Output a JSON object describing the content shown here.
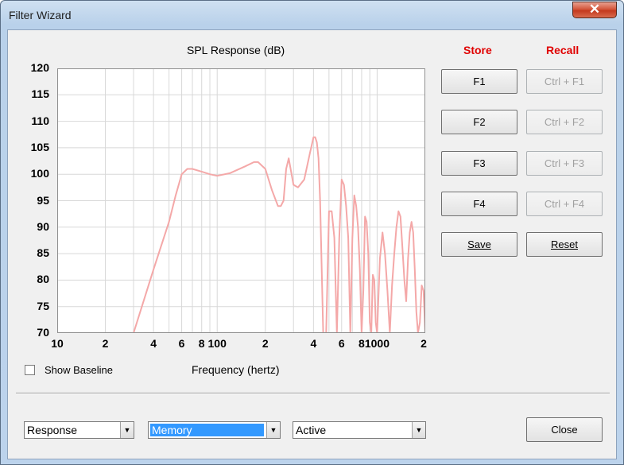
{
  "window": {
    "title": "Filter Wizard",
    "close_glyph": "✕"
  },
  "header": {
    "store": "Store",
    "recall": "Recall"
  },
  "chart_data": {
    "type": "line",
    "title": "SPL Response (dB)",
    "xlabel": "Frequency (hertz)",
    "ylabel": "",
    "x_scale": "log",
    "xlim": [
      10,
      2000
    ],
    "ylim": [
      70,
      120
    ],
    "y_ticks": [
      "120",
      "115",
      "110",
      "105",
      "100",
      "95",
      "90",
      "85",
      "80",
      "75",
      "70"
    ],
    "x_ticks": [
      {
        "v": 10,
        "label": "10"
      },
      {
        "v": 20,
        "label": "2"
      },
      {
        "v": 40,
        "label": "4"
      },
      {
        "v": 60,
        "label": "6"
      },
      {
        "v": 80,
        "label": "8"
      },
      {
        "v": 100,
        "label": "100"
      },
      {
        "v": 200,
        "label": "2"
      },
      {
        "v": 400,
        "label": "4"
      },
      {
        "v": 600,
        "label": "6"
      },
      {
        "v": 800,
        "label": "8"
      },
      {
        "v": 1000,
        "label": "1000"
      },
      {
        "v": 2000,
        "label": "2"
      }
    ],
    "grid": true,
    "series_color": "#f4a8a8",
    "series": [
      {
        "x": [
          30,
          40,
          50,
          55,
          60,
          65,
          70,
          80,
          90,
          100,
          120,
          150,
          170,
          180,
          200,
          220,
          240,
          250,
          260,
          270,
          280,
          300,
          320,
          350,
          380,
          400,
          410,
          420,
          430,
          440,
          460,
          480,
          500,
          520,
          540,
          560,
          580,
          600,
          620,
          640,
          660,
          680,
          700,
          720,
          740,
          760,
          780,
          800,
          820,
          840,
          860,
          880,
          900,
          920,
          940,
          960,
          980,
          1000,
          1040,
          1080,
          1120,
          1160,
          1200,
          1240,
          1280,
          1320,
          1360,
          1400,
          1440,
          1480,
          1520,
          1560,
          1600,
          1640,
          1680,
          1720,
          1760,
          1800,
          1850,
          1900,
          1950,
          2000
        ],
        "y": [
          70,
          82,
          91,
          96,
          100,
          101,
          101,
          100.5,
          100,
          99.7,
          100.2,
          101.5,
          102.3,
          102.3,
          101,
          97,
          94,
          94,
          95,
          101,
          103,
          98,
          97.5,
          99,
          104,
          107,
          107,
          106,
          103,
          95,
          70,
          70,
          93,
          93,
          88,
          70,
          88,
          99,
          98,
          94,
          88,
          70,
          88,
          96,
          94,
          90,
          82,
          70,
          78,
          92,
          91,
          85,
          72,
          70,
          81,
          80,
          72,
          70,
          84,
          89,
          85,
          78,
          70,
          79,
          85,
          90,
          93,
          92,
          86,
          80,
          76,
          84,
          89,
          91,
          89,
          82,
          74,
          70,
          72,
          79,
          78,
          70
        ]
      }
    ]
  },
  "show_baseline": {
    "label": "Show Baseline",
    "checked": false
  },
  "store_buttons": [
    "F1",
    "F2",
    "F3",
    "F4"
  ],
  "recall_buttons": [
    "Ctrl + F1",
    "Ctrl + F2",
    "Ctrl + F3",
    "Ctrl + F4"
  ],
  "save_button": "Save",
  "reset_button": "Reset",
  "dropdowns": {
    "view": "Response",
    "source": "Memory",
    "state": "Active"
  },
  "close_button": "Close"
}
